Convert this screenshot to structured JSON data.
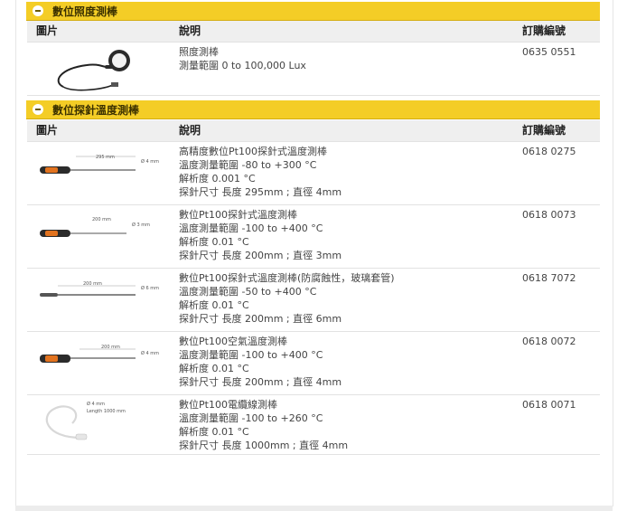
{
  "sections": [
    {
      "title": "數位照度測棒",
      "headers": {
        "image": "圖片",
        "desc": "說明",
        "order": "訂購編號"
      },
      "rows": [
        {
          "desc": [
            "照度測棒",
            "測量範圍 0 to 100,000 Lux"
          ],
          "order": "0635 0551"
        }
      ]
    },
    {
      "title": "數位探針溫度測棒",
      "headers": {
        "image": "圖片",
        "desc": "說明",
        "order": "訂購編號"
      },
      "rows": [
        {
          "desc": [
            "高精度數位Pt100探針式溫度測棒",
            "溫度測量範圍 -80 to +300 °C",
            "解析度 0.001 °C",
            "探針尺寸 長度 295mm ; 直徑 4mm"
          ],
          "order": "0618 0275",
          "probe_label": "295 mm",
          "dia_label": "Ø 4 mm"
        },
        {
          "desc": [
            "數位Pt100探針式溫度測棒",
            "溫度測量範圍 -100 to +400 °C",
            "解析度 0.01 °C",
            "探針尺寸 長度 200mm ; 直徑 3mm"
          ],
          "order": "0618 0073",
          "probe_label": "200 mm",
          "dia_label": "Ø 3 mm"
        },
        {
          "desc": [
            "數位Pt100探針式溫度測棒(防腐蝕性，玻璃套管)",
            "溫度測量範圍 -50 to +400 °C",
            "解析度 0.01 °C",
            "探針尺寸 長度 200mm ; 直徑 6mm"
          ],
          "order": "0618 7072",
          "probe_label": "200 mm",
          "dia_label": "Ø 6 mm"
        },
        {
          "desc": [
            "數位Pt100空氣溫度測棒",
            "溫度測量範圍 -100 to +400 °C",
            "解析度 0.01 °C",
            "探針尺寸 長度 200mm ; 直徑 4mm"
          ],
          "order": "0618 0072",
          "probe_label": "200 mm",
          "dia_label": "Ø 4 mm"
        },
        {
          "desc": [
            "數位Pt100電纜線測棒",
            "溫度測量範圍 -100 to +260 °C",
            "解析度 0.01 °C",
            "探針尺寸 長度 1000mm ; 直徑 4mm"
          ],
          "order": "0618 0071",
          "probe_label": "Length 1000 mm",
          "dia_label": "Ø 4 mm"
        }
      ]
    }
  ],
  "colors": {
    "section_bar": "#f4cd26",
    "probe_handle": "#2b2b2b",
    "probe_accent": "#e2731f"
  }
}
